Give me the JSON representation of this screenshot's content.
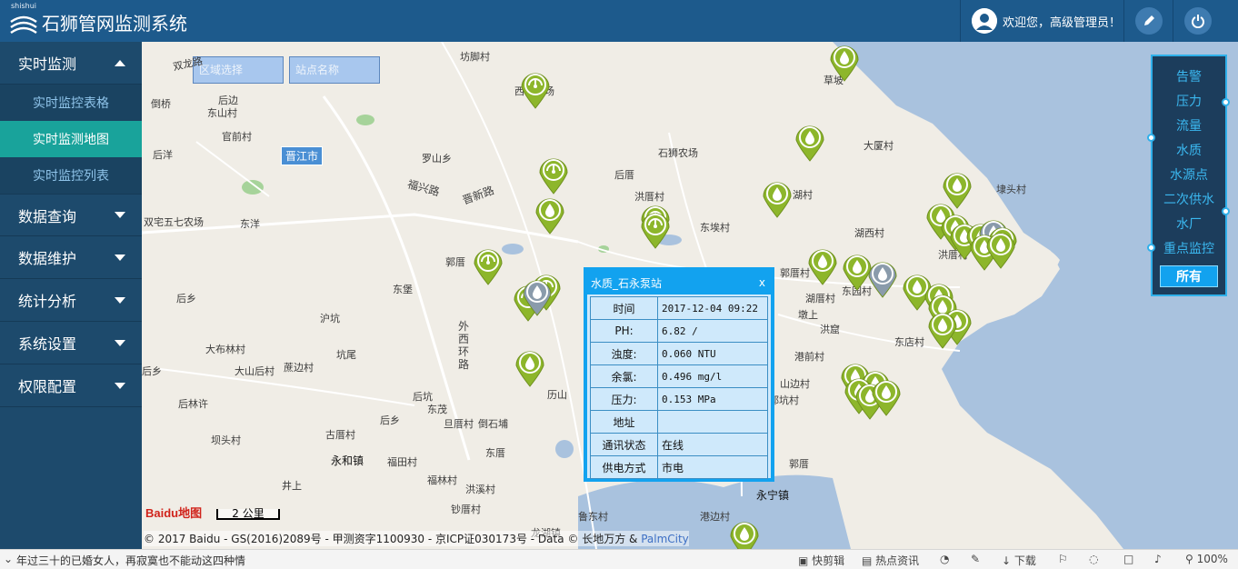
{
  "header": {
    "logo_small_text": "shishui",
    "title": "石狮管网监测系统",
    "welcome": "欢迎您，高级管理员！",
    "edit_icon": "pencil-icon",
    "power_icon": "power-icon"
  },
  "sidebar": {
    "groups": [
      {
        "label": "实时监测",
        "expanded": true,
        "items": [
          {
            "label": "实时监控表格",
            "active": false
          },
          {
            "label": "实时监测地图",
            "active": true
          },
          {
            "label": "实时监控列表",
            "active": false
          }
        ]
      },
      {
        "label": "数据查询",
        "expanded": false
      },
      {
        "label": "数据维护",
        "expanded": false
      },
      {
        "label": "统计分析",
        "expanded": false
      },
      {
        "label": "系统设置",
        "expanded": false
      },
      {
        "label": "权限配置",
        "expanded": false
      }
    ]
  },
  "filters": {
    "region_placeholder": "区域选择",
    "station_placeholder": "站点名称"
  },
  "map": {
    "city_tag": "晋江市",
    "places": [
      "双龙路",
      "坊脚村",
      "西坑农场",
      "倒桥",
      "后边",
      "东山村",
      "官前村",
      "后洋",
      "罗山乡",
      "石狮农场",
      "后厝",
      "福兴路",
      "晋新路",
      "洪厝村",
      "湖村",
      "东埃村",
      "双宅五七农场",
      "东洋",
      "郭厝",
      "草坡",
      "大厦村",
      "埭头村",
      "湖西村",
      "洪厝村",
      "郭厝村",
      "东园村",
      "湖厝村",
      "墩上",
      "洪窟",
      "东店村",
      "港前村",
      "山边村",
      "郭厝",
      "沪坑",
      "东堡",
      "外西环路",
      "坑尾",
      "大布林村",
      "大山后村",
      "蔗边村",
      "后乡",
      "后林许",
      "后乡",
      "东茂",
      "旦厝村",
      "倒石埔",
      "后坑",
      "坝头村",
      "古厝村",
      "永和镇",
      "福田村",
      "东厝",
      "福林村",
      "洪溪村",
      "井上",
      "钞厝村",
      "郭坑村",
      "永宁镇",
      "港边村",
      "历山",
      "鲁东村",
      "龙湖镇",
      "后乡"
    ]
  },
  "type_panel": {
    "items": [
      "告警",
      "压力",
      "流量",
      "水质",
      "水源点",
      "二次供水",
      "水厂",
      "重点监控"
    ],
    "active": "所有"
  },
  "popup": {
    "title": "水质_石永泵站",
    "close": "x",
    "rows": [
      {
        "key": "时间",
        "value": "2017-12-04 09:22"
      },
      {
        "key": "PH:",
        "value": "6.82 /"
      },
      {
        "key": "浊度:",
        "value": "0.060 NTU"
      },
      {
        "key": "余氯:",
        "value": "0.496 mg/l"
      },
      {
        "key": "压力:",
        "value": "0.153 MPa"
      },
      {
        "key": "地址",
        "value": ""
      },
      {
        "key": "通讯状态",
        "value": "在线"
      },
      {
        "key": "供电方式",
        "value": "市电"
      }
    ]
  },
  "map_footer": {
    "baidu_logo": "Baidu地图",
    "scale": "2 公里",
    "copyright": "© 2017 Baidu - GS(2016)2089号 - 甲测资字1100930 - 京ICP证030173号 - Data © 长地万方 & ",
    "palmcity": "PalmCity"
  },
  "statusbar": {
    "news": "年过三十的已婚女人，再寂寞也不能动这四种情",
    "cut": "快剪辑",
    "hot": "热点资讯",
    "download": "下载",
    "zoom": "100%"
  },
  "colors": {
    "header": "#1d5a8c",
    "sidebar": "#1d4a6c",
    "active_item": "#19a39b",
    "accent": "#12a2ef",
    "marker_green": "#8db62b",
    "marker_gray": "#8a9bab"
  }
}
